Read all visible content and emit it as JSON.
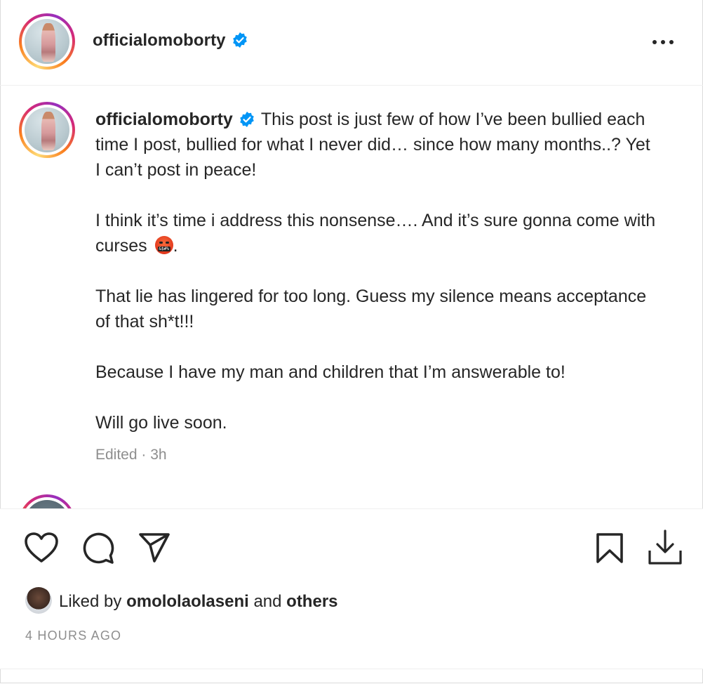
{
  "header": {
    "username": "officialomoborty",
    "verified_icon": "verified-badge-icon",
    "more_icon": "more-horizontal-icon"
  },
  "caption": {
    "username": "officialomoborty",
    "paragraphs": [
      "This post is just few of how I’ve been bullied each time I post, bullied for what I never did… since how many months..? Yet I can’t post in peace!",
      "I think it’s time i address this nonsense…. And it’s sure gonna come with curses",
      "That lie has lingered for too long. Guess my silence means acceptance of that sh*t!!!",
      "Because I have my man and children that I’m answerable to!",
      "Will go live soon."
    ],
    "emoji_after_p2": "🤬",
    "trailing_period": ".",
    "edited_label": "Edited",
    "separator": "·",
    "time_ago": "3h"
  },
  "actions": {
    "like_icon": "heart-icon",
    "comment_icon": "comment-icon",
    "share_icon": "send-icon",
    "save_icon": "bookmark-icon",
    "download_icon": "download-icon"
  },
  "likes": {
    "prefix": "Liked by",
    "user": "omololaolaseni",
    "connector": "and",
    "others": "others"
  },
  "timestamp": "4 HOURS AGO",
  "colors": {
    "text": "#262626",
    "secondary": "#8e8e8e",
    "verified": "#0095f6",
    "divider": "#efefef"
  }
}
